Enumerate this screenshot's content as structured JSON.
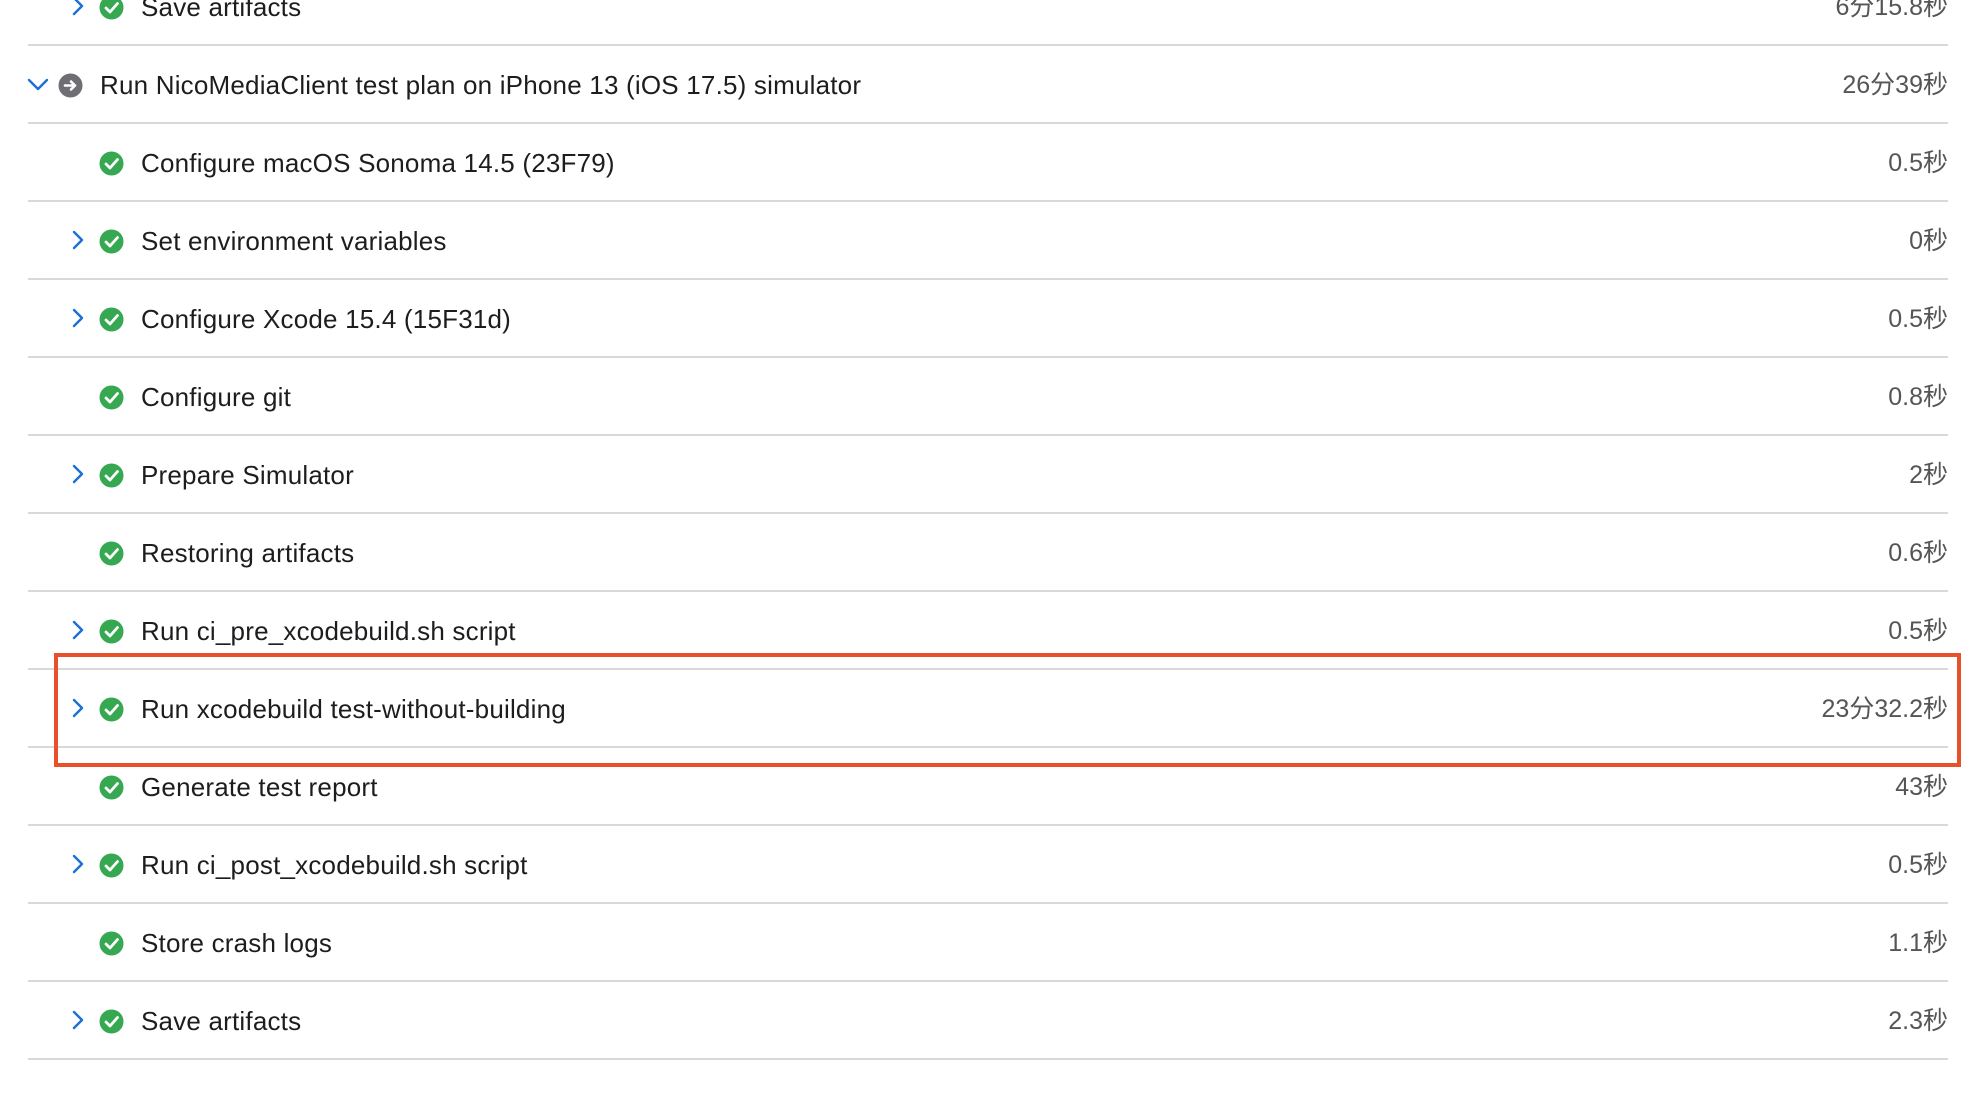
{
  "colors": {
    "success": "#36a852",
    "running": "#6e6e73",
    "chevron": "#1b6fd6",
    "highlight": "#e8502b"
  },
  "steps": [
    {
      "label": "Save artifacts",
      "duration": "6分15.8秒",
      "status": "success",
      "expandable": true
    },
    {
      "label": "Run NicoMediaClient test plan on iPhone 13 (iOS 17.5) simulator",
      "duration": "26分39秒",
      "status": "running",
      "expandable": true,
      "expanded": true,
      "group": true
    },
    {
      "label": "Configure macOS Sonoma 14.5 (23F79)",
      "duration": "0.5秒",
      "status": "success",
      "expandable": false
    },
    {
      "label": "Set environment variables",
      "duration": "0秒",
      "status": "success",
      "expandable": true
    },
    {
      "label": "Configure Xcode 15.4 (15F31d)",
      "duration": "0.5秒",
      "status": "success",
      "expandable": true
    },
    {
      "label": "Configure git",
      "duration": "0.8秒",
      "status": "success",
      "expandable": false
    },
    {
      "label": "Prepare Simulator",
      "duration": "2秒",
      "status": "success",
      "expandable": true
    },
    {
      "label": "Restoring artifacts",
      "duration": "0.6秒",
      "status": "success",
      "expandable": false
    },
    {
      "label": "Run ci_pre_xcodebuild.sh script",
      "duration": "0.5秒",
      "status": "success",
      "expandable": true
    },
    {
      "label": "Run xcodebuild test-without-building",
      "duration": "23分32.2秒",
      "status": "success",
      "expandable": true,
      "highlighted": true
    },
    {
      "label": "Generate test report",
      "duration": "43秒",
      "status": "success",
      "expandable": false
    },
    {
      "label": "Run ci_post_xcodebuild.sh script",
      "duration": "0.5秒",
      "status": "success",
      "expandable": true
    },
    {
      "label": "Store crash logs",
      "duration": "1.1秒",
      "status": "success",
      "expandable": false
    },
    {
      "label": "Save artifacts",
      "duration": "2.3秒",
      "status": "success",
      "expandable": true
    }
  ]
}
